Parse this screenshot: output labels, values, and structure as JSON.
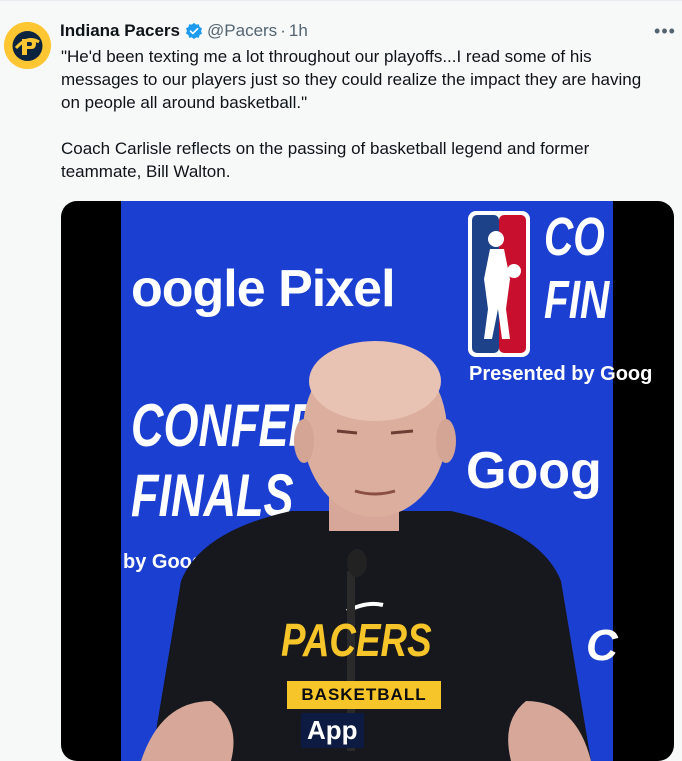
{
  "tweet": {
    "author_name": "Indiana Pacers",
    "handle": "@Pacers",
    "separator": "·",
    "time": "1h",
    "more_icon": "more-icon",
    "paragraphs": [
      "\"He'd been texting me a lot throughout our playoffs...I read some of his messages to our players just so they could realize the impact they are having on people all around basketball.\"",
      "Coach Carlisle reflects on the passing of basketball legend and former teammate, Bill Walton."
    ]
  },
  "media": {
    "backdrop": {
      "google_pixel": "oogle Pixel",
      "conference_top": "CO",
      "finals_top": "FIN",
      "presented_top": "Presented by Goog",
      "conference_left": "CONFERE",
      "finals_left": "FINALS",
      "presented_left": "by Goog",
      "google_right": "Goog",
      "partial_right": "C"
    },
    "shirt": {
      "team": "PACERS",
      "sub": "BASKETBALL"
    },
    "mic_label": "App"
  },
  "colors": {
    "avatar_bg": "#ffc633",
    "verified_blue": "#1d9bf0",
    "backdrop_blue": "#1b3fd0",
    "shirt_yellow": "#f6c52a"
  }
}
